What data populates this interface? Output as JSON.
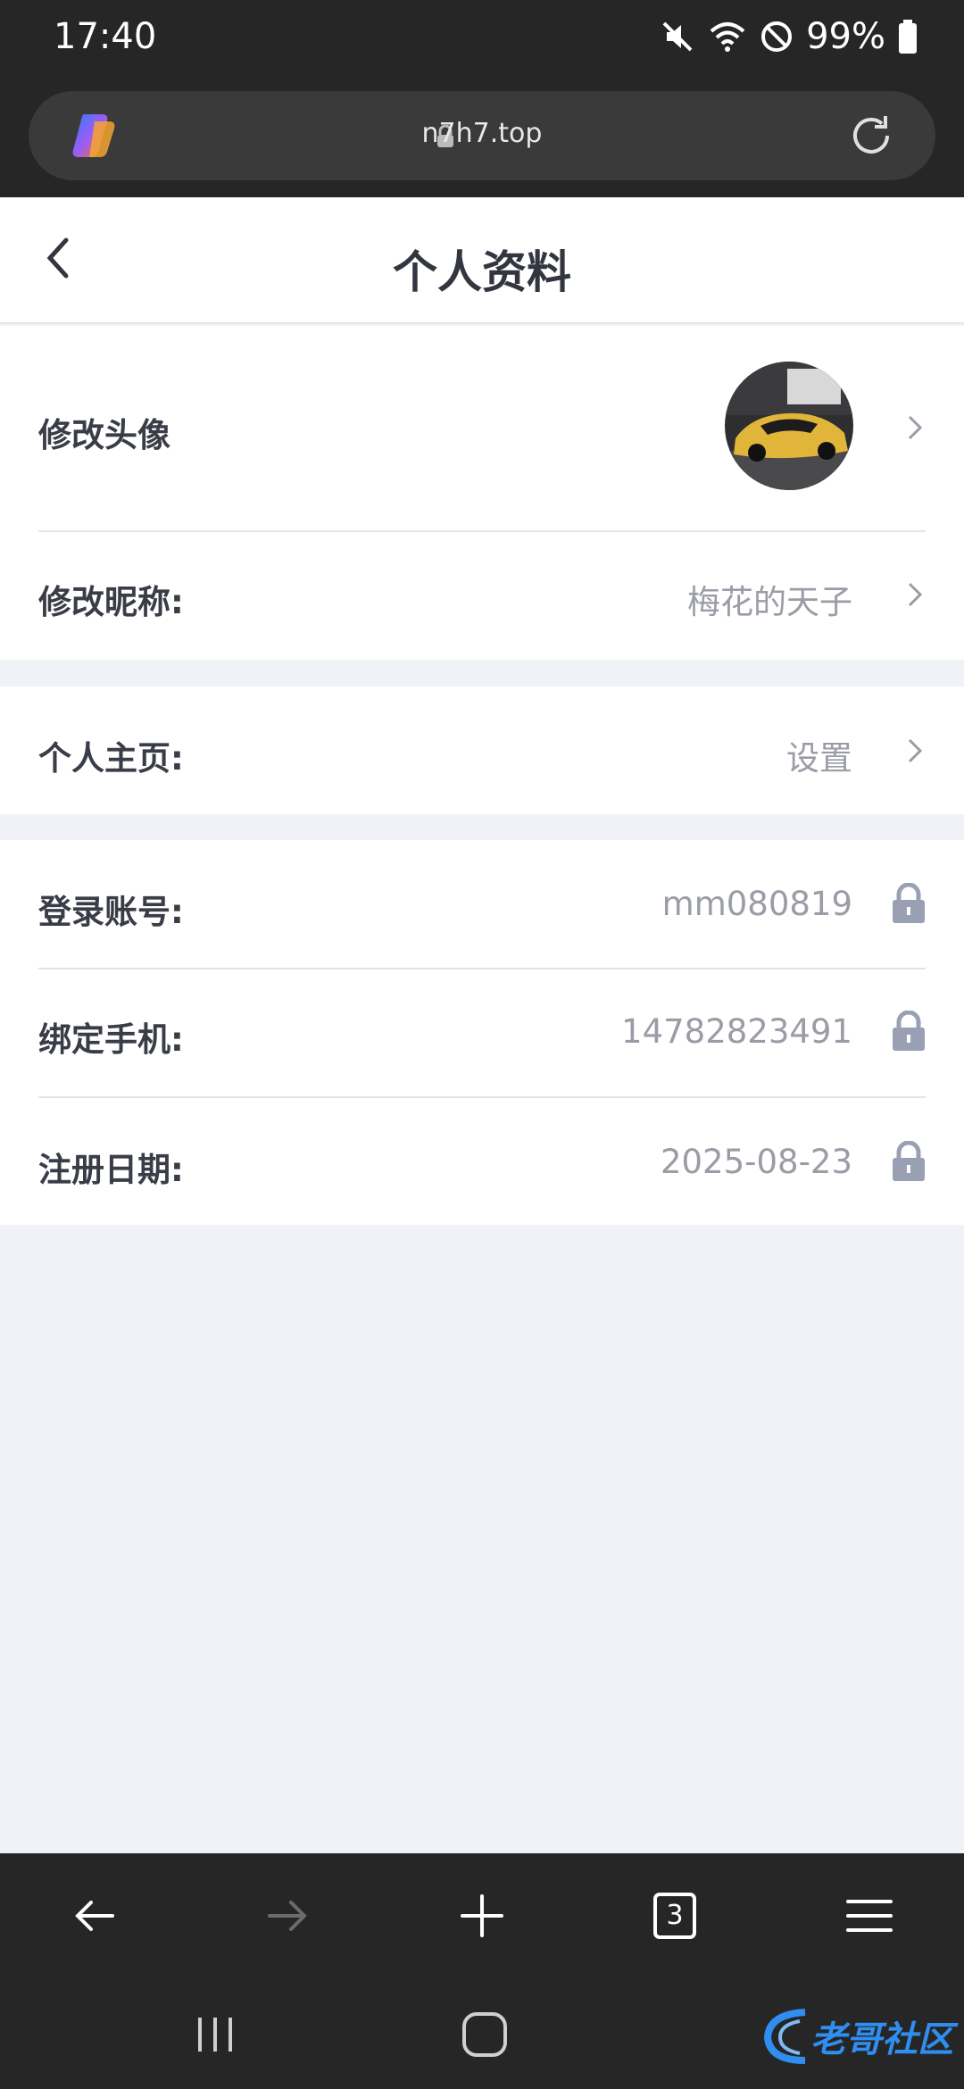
{
  "status_bar": {
    "time": "17:40",
    "battery": "99%"
  },
  "browser": {
    "url": "n7h7.top",
    "tab_count": "3"
  },
  "header": {
    "title": "个人资料"
  },
  "profile": {
    "avatar_label": "修改头像",
    "nickname_label": "修改昵称:",
    "nickname_value": "梅花的天子",
    "homepage_label": "个人主页:",
    "homepage_value": "设置",
    "account_label": "登录账号:",
    "account_value": "mm080819",
    "phone_label": "绑定手机:",
    "phone_value": "14782823491",
    "register_label": "注册日期:",
    "register_value": "2025-08-23"
  },
  "watermark": {
    "text": "老哥社区"
  },
  "colors": {
    "chrome_bg": "#262626",
    "page_bg": "#f0f2f7",
    "label": "#3a3d47",
    "value": "#9a9ca6",
    "lock": "#9aa0b4"
  }
}
